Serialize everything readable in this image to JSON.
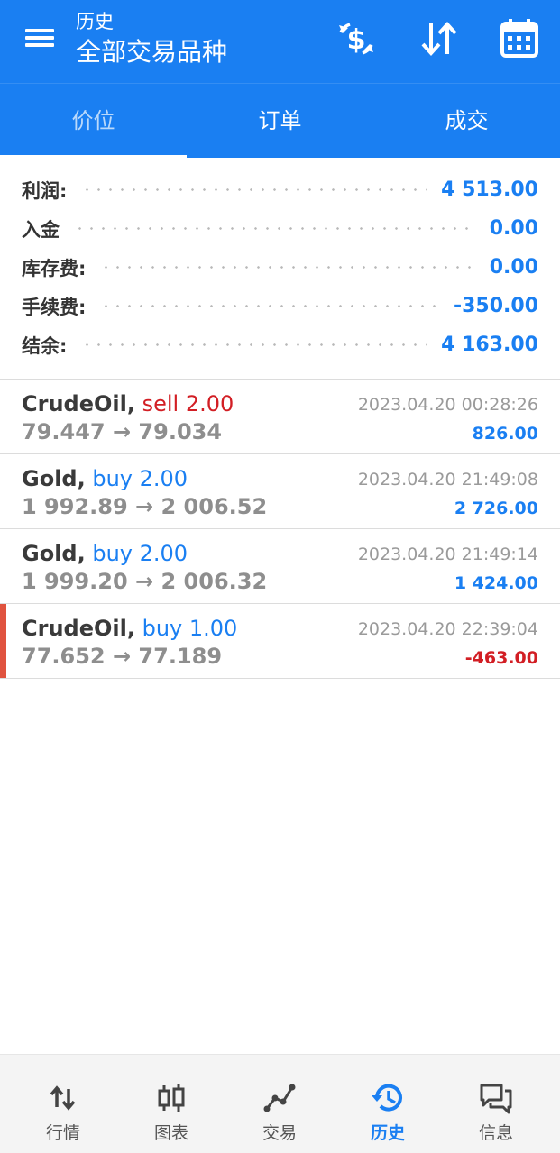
{
  "header": {
    "subtitle": "历史",
    "title": "全部交易品种",
    "icons": [
      "menu-icon",
      "currency-exchange-icon",
      "sort-icon",
      "calendar-icon"
    ]
  },
  "tabs": [
    {
      "label": "价位",
      "active": true
    },
    {
      "label": "订单",
      "active": false
    },
    {
      "label": "成交",
      "active": false
    }
  ],
  "summary": [
    {
      "label": "利润:",
      "value": "4 513.00"
    },
    {
      "label": "入金",
      "value": "0.00"
    },
    {
      "label": "库存费:",
      "value": "0.00"
    },
    {
      "label": "手续费:",
      "value": "-350.00"
    },
    {
      "label": "结余:",
      "value": "4 163.00"
    }
  ],
  "deals": [
    {
      "symbol": "CrudeOil,",
      "side": "sell 2.00",
      "side_type": "sell",
      "prices": "79.447 → 79.034",
      "time": "2023.04.20 00:28:26",
      "profit": "826.00",
      "profit_sign": "pos"
    },
    {
      "symbol": "Gold,",
      "side": "buy 2.00",
      "side_type": "buy",
      "prices": "1 992.89 → 2 006.52",
      "time": "2023.04.20 21:49:08",
      "profit": "2 726.00",
      "profit_sign": "pos"
    },
    {
      "symbol": "Gold,",
      "side": "buy 2.00",
      "side_type": "buy",
      "prices": "1 999.20 → 2 006.32",
      "time": "2023.04.20 21:49:14",
      "profit": "1 424.00",
      "profit_sign": "pos"
    },
    {
      "symbol": "CrudeOil,",
      "side": "buy 1.00",
      "side_type": "buy",
      "prices": "77.652 → 77.189",
      "time": "2023.04.20 22:39:04",
      "profit": "-463.00",
      "profit_sign": "neg"
    }
  ],
  "nav": [
    {
      "label": "行情",
      "icon": "quotes-icon",
      "active": false
    },
    {
      "label": "图表",
      "icon": "chart-icon",
      "active": false
    },
    {
      "label": "交易",
      "icon": "trade-icon",
      "active": false
    },
    {
      "label": "历史",
      "icon": "history-icon",
      "active": true
    },
    {
      "label": "信息",
      "icon": "messages-icon",
      "active": false
    }
  ],
  "colors": {
    "primary": "#1a7ff2",
    "negative": "#d21e24",
    "marker": "#e0533f"
  }
}
